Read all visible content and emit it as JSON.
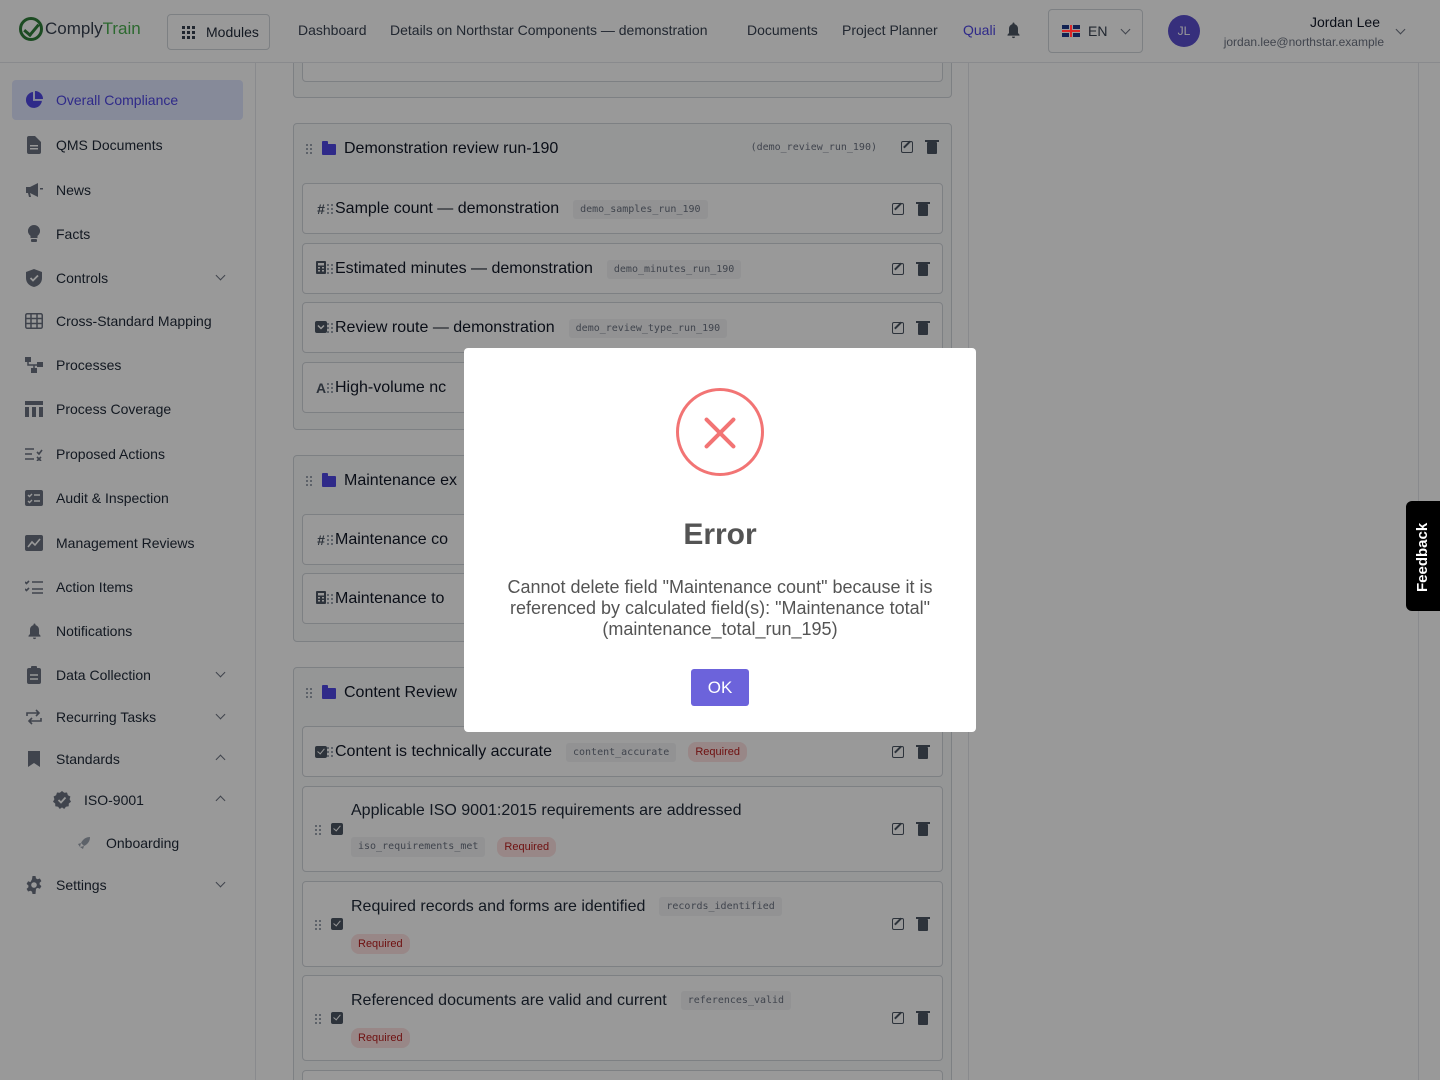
{
  "app": {
    "logo_left": "Comply",
    "logo_right": "Train",
    "modules_label": "Modules"
  },
  "topnav": {
    "items": [
      "Dashboard",
      "Details on Northstar Components — demonstration",
      "Documents",
      "Project Planner",
      "Quali"
    ],
    "active_index": 4
  },
  "lang": {
    "code": "EN"
  },
  "user": {
    "initials": "JL",
    "name": "Jordan Lee",
    "email": "jordan.lee@northstar.example"
  },
  "sidebar": {
    "items": [
      {
        "label": "Overall Compliance",
        "icon": "pie-chart-icon",
        "active": true
      },
      {
        "label": "QMS Documents",
        "icon": "document-icon"
      },
      {
        "label": "News",
        "icon": "megaphone-icon"
      },
      {
        "label": "Facts",
        "icon": "lightbulb-icon"
      },
      {
        "label": "Controls",
        "icon": "shield-icon",
        "expandable": true
      },
      {
        "label": "Cross-Standard Mapping",
        "icon": "table-icon"
      },
      {
        "label": "Processes",
        "icon": "process-icon"
      },
      {
        "label": "Process Coverage",
        "icon": "coverage-icon"
      },
      {
        "label": "Proposed Actions",
        "icon": "list-check-icon"
      },
      {
        "label": "Audit & Inspection",
        "icon": "audit-icon"
      },
      {
        "label": "Management Reviews",
        "icon": "review-icon"
      },
      {
        "label": "Action Items",
        "icon": "checklist-icon"
      },
      {
        "label": "Notifications",
        "icon": "bell-icon"
      },
      {
        "label": "Data Collection",
        "icon": "clipboard-icon",
        "expandable": true
      },
      {
        "label": "Recurring Tasks",
        "icon": "repeat-icon",
        "expandable": true
      },
      {
        "label": "Standards",
        "icon": "bookmark-icon",
        "expanded": true
      },
      {
        "label": "ISO-9001",
        "icon": "badge-icon",
        "expanded": true
      },
      {
        "label": "Onboarding",
        "icon": "rocket-icon"
      },
      {
        "label": "Settings",
        "icon": "gear-icon",
        "expandable": true
      }
    ]
  },
  "groups": [
    {
      "title": "Demonstration review run-190",
      "key": "(demo_review_run_190)",
      "fields": [
        {
          "type": "#",
          "label": "Sample count — demonstration",
          "code": "demo_samples_run_190"
        },
        {
          "type": "calc",
          "label": "Estimated minutes — demonstration",
          "code": "demo_minutes_run_190"
        },
        {
          "type": "select",
          "label": "Review route — demonstration",
          "code": "demo_review_type_run_190"
        },
        {
          "type": "A",
          "label": "High-volume nc"
        }
      ]
    },
    {
      "title": "Maintenance ex",
      "fields": [
        {
          "type": "#",
          "label": "Maintenance co"
        },
        {
          "type": "calc",
          "label": "Maintenance to"
        }
      ]
    },
    {
      "title": "Content Review",
      "fields": [
        {
          "type": "check",
          "label": "Content is technically accurate",
          "code": "content_accurate",
          "required": "Required"
        },
        {
          "type": "check",
          "label": "Applicable ISO 9001:2015 requirements are addressed",
          "code": "iso_requirements_met",
          "required": "Required"
        },
        {
          "type": "check",
          "label": "Required records and forms are identified",
          "code": "records_identified",
          "required": "Required"
        },
        {
          "type": "check",
          "label": "Referenced documents are valid and current",
          "code": "references_valid",
          "required": "Required"
        }
      ]
    }
  ],
  "modal": {
    "title": "Error",
    "message": "Cannot delete field \"Maintenance count\" because it is referenced by calculated field(s): \"Maintenance total\" (maintenance_total_run_195)",
    "ok_label": "OK"
  },
  "feedback_label": "Feedback",
  "colors": {
    "accent": "#4f46e5",
    "error": "#f27474",
    "ok_button": "#6c63db",
    "brand_green": "#4caf50"
  }
}
